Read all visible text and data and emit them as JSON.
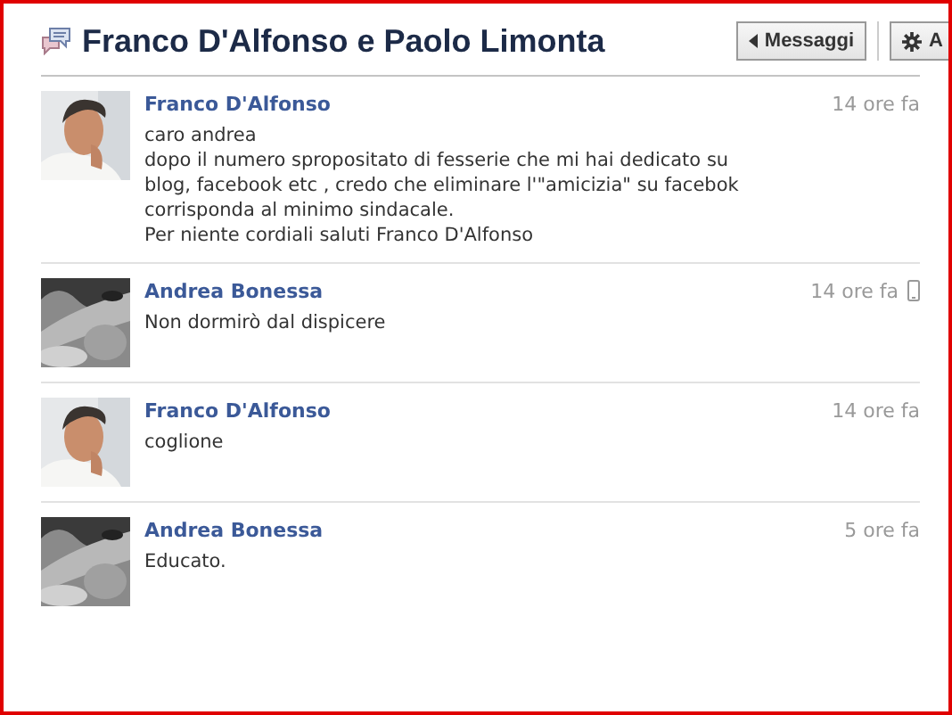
{
  "header": {
    "title": "Franco D'Alfonso e Paolo Limonta",
    "buttons": [
      {
        "label": "Messaggi",
        "kind": "back"
      },
      {
        "label": "A",
        "kind": "settings"
      }
    ]
  },
  "messages": [
    {
      "author": "Franco D'Alfonso",
      "time": "14 ore fa",
      "mobile": false,
      "kind": "franco",
      "lines": [
        "caro andrea",
        "dopo il numero spropositato di fesserie che mi hai dedicato su",
        "blog, facebook etc , credo che eliminare l'\"amicizia\" su facebok",
        "corrisponda al minimo sindacale.",
        "Per niente cordiali saluti Franco D'Alfonso"
      ]
    },
    {
      "author": "Andrea Bonessa",
      "time": "14 ore fa",
      "mobile": true,
      "kind": "andrea",
      "lines": [
        "Non dormirò dal dispicere"
      ]
    },
    {
      "author": "Franco D'Alfonso",
      "time": "14 ore fa",
      "mobile": false,
      "kind": "franco",
      "lines": [
        "coglione"
      ]
    },
    {
      "author": "Andrea Bonessa",
      "time": "5 ore fa",
      "mobile": false,
      "kind": "andrea",
      "lines": [
        "Educato."
      ]
    }
  ]
}
